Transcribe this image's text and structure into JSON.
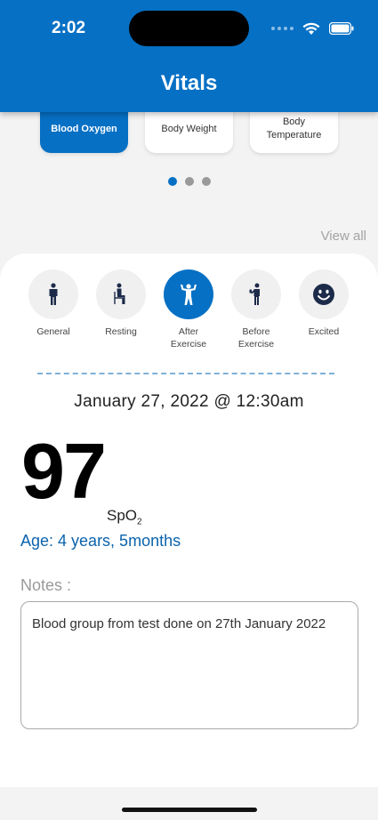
{
  "status_bar": {
    "time": "2:02"
  },
  "header": {
    "title": "Vitals"
  },
  "vital_types": [
    {
      "label": "Blood Oxygen",
      "active": true
    },
    {
      "label": "Body Weight",
      "active": false
    },
    {
      "label": "Body Temperature",
      "active": false
    }
  ],
  "pager": {
    "pages": 3,
    "current": 1
  },
  "view_all_label": "View all",
  "states": [
    {
      "label": "General",
      "icon": "standing-person-icon"
    },
    {
      "label": "Resting",
      "icon": "sitting-person-icon"
    },
    {
      "label": "After Exercise",
      "icon": "flexing-person-icon",
      "active": true
    },
    {
      "label": "Before Exercise",
      "icon": "drinking-person-icon"
    },
    {
      "label": "Excited",
      "icon": "smiley-icon"
    }
  ],
  "reading": {
    "datetime": "January 27, 2022 @ 12:30am",
    "value": "97",
    "unit_main": "SpO",
    "unit_sub": "2",
    "age": "Age:  4 years, 5months"
  },
  "notes": {
    "label": "Notes :",
    "text": "Blood group from test done on 27th January 2022"
  },
  "colors": {
    "primary": "#0670c4",
    "age_text": "#0b63ad"
  }
}
